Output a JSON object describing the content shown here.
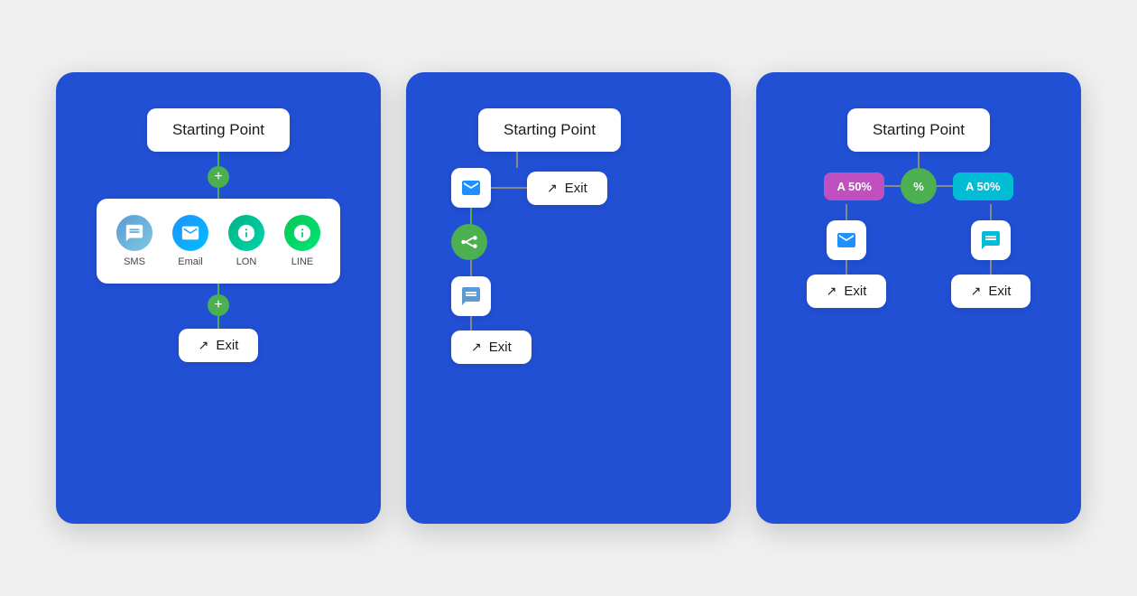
{
  "card1": {
    "starting_point": "Starting Point",
    "exit_label": "Exit",
    "channels": [
      {
        "label": "SMS",
        "color": "#5b9bd5",
        "icon": "💬"
      },
      {
        "label": "Email",
        "color": "#1e90ff",
        "icon": "✉️"
      },
      {
        "label": "LON",
        "color": "#00b388",
        "icon": "🔔"
      },
      {
        "label": "LINE",
        "color": "#06c755",
        "icon": "🟢"
      }
    ]
  },
  "card2": {
    "starting_point": "Starting Point",
    "exit_label": "Exit"
  },
  "card3": {
    "starting_point": "Starting Point",
    "branch_a_left": "A 50%",
    "branch_a_right": "A 50%",
    "exit_left": "Exit",
    "exit_right": "Exit"
  },
  "icons": {
    "exit": "↗",
    "email": "✉",
    "sms": "💬",
    "split": "⇄",
    "percent": "%"
  }
}
